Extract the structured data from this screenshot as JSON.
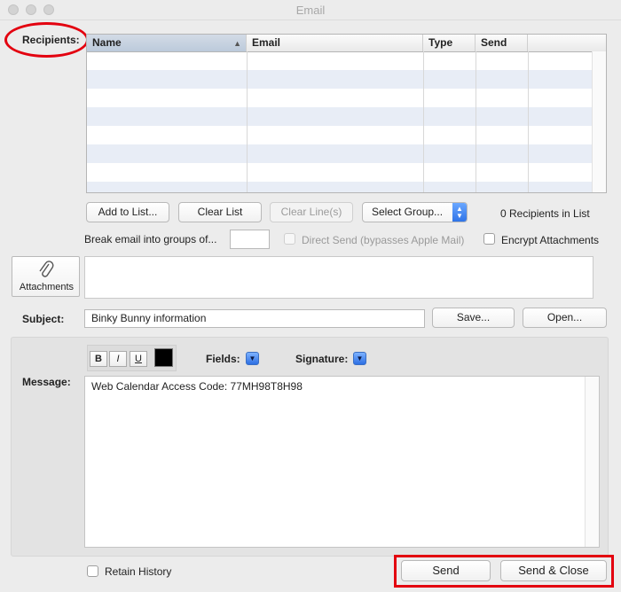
{
  "window": {
    "title": "Email"
  },
  "recipients": {
    "label": "Recipients:",
    "columns": [
      "Name",
      "Email",
      "Type",
      "Send"
    ],
    "rows": [],
    "add_button": "Add to List...",
    "clear_button": "Clear List",
    "clear_lines_button": "Clear Line(s)",
    "select_group": "Select Group...",
    "count_text": "0 Recipients in List"
  },
  "options": {
    "break_label": "Break email into groups of...",
    "break_value": "",
    "direct_send_label": "Direct Send (bypasses Apple Mail)",
    "encrypt_label": "Encrypt Attachments"
  },
  "attachments": {
    "button_label": "Attachments",
    "icon": "paperclip-icon"
  },
  "subject": {
    "label": "Subject:",
    "value": "Binky Bunny information",
    "save_button": "Save...",
    "open_button": "Open..."
  },
  "message": {
    "label": "Message:",
    "bold": "B",
    "italic": "I",
    "underline": "U",
    "text_color": "#000000",
    "fields_label": "Fields:",
    "signature_label": "Signature:",
    "body": "Web Calendar Access Code: 77MH98T8H98"
  },
  "footer": {
    "retain_history_label": "Retain History",
    "send_button": "Send",
    "send_close_button": "Send & Close"
  },
  "colors": {
    "annotation_red": "#e3000f",
    "row_alt": "#e8edf6",
    "accent_blue": "#2f74e8"
  }
}
